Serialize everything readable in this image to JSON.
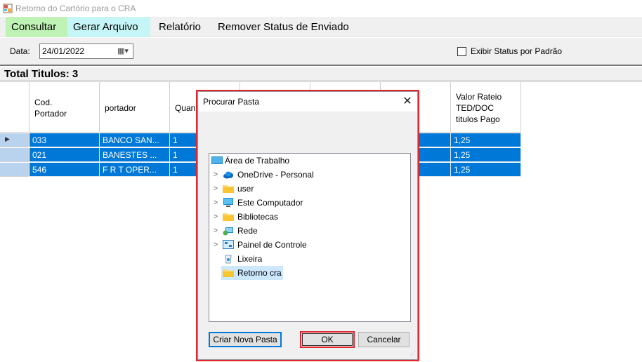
{
  "window": {
    "title": "Retorno do Cartório para o CRA"
  },
  "menu": {
    "items": [
      {
        "label": "Consultar",
        "color": "#bff2b5"
      },
      {
        "label": "Gerar Arquivo",
        "color": "#c5f5f6"
      },
      {
        "label": "Relatório"
      },
      {
        "label": "Remover Status de Enviado"
      }
    ]
  },
  "filters": {
    "date_label": "Data:",
    "date_value": "24/01/2022",
    "status_checkbox_label": "Exibir Status por Padrão",
    "status_checked": false
  },
  "totals": {
    "label": "Total Titulos: 3"
  },
  "grid": {
    "columns": [
      {
        "label": "Cod.\nPortador"
      },
      {
        "label": "portador"
      },
      {
        "label": "Quan"
      },
      {
        "label": ""
      },
      {
        "label": ""
      },
      {
        "label": ""
      },
      {
        "label": "Valor Rateio\nTED/DOC\ntitulos Pago"
      }
    ],
    "rows": [
      {
        "current": true,
        "cells": [
          "033",
          "BANCO SAN...",
          "1",
          "",
          "",
          "",
          "1,25"
        ]
      },
      {
        "current": false,
        "cells": [
          "021",
          "BANESTES ...",
          "1",
          "",
          "",
          "",
          "1,25"
        ]
      },
      {
        "current": false,
        "cells": [
          "546",
          "F R T OPER...",
          "1",
          "",
          "",
          "",
          "1,25"
        ]
      }
    ],
    "selection_color": "#0078d7"
  },
  "dialog": {
    "title": "Procurar Pasta",
    "tree": [
      {
        "label": "Área de Trabalho",
        "icon": "desktop-icon",
        "expandable": false,
        "selected": false
      },
      {
        "label": "OneDrive - Personal",
        "icon": "cloud-icon",
        "expandable": true,
        "selected": false
      },
      {
        "label": "user",
        "icon": "folder-icon",
        "expandable": true,
        "selected": false
      },
      {
        "label": "Este Computador",
        "icon": "computer-icon",
        "expandable": true,
        "selected": false
      },
      {
        "label": "Bibliotecas",
        "icon": "folder-icon",
        "expandable": true,
        "selected": false
      },
      {
        "label": "Rede",
        "icon": "network-icon",
        "expandable": true,
        "selected": false
      },
      {
        "label": "Painel de Controle",
        "icon": "control-panel-icon",
        "expandable": true,
        "selected": false
      },
      {
        "label": "Lixeira",
        "icon": "recycle-bin-icon",
        "expandable": false,
        "selected": false
      },
      {
        "label": "Retorno cra",
        "icon": "folder-icon",
        "expandable": false,
        "selected": true
      }
    ],
    "buttons": {
      "new_folder": "Criar Nova Pasta",
      "ok": "OK",
      "cancel": "Cancelar"
    },
    "highlight_color": "#e0262e"
  }
}
